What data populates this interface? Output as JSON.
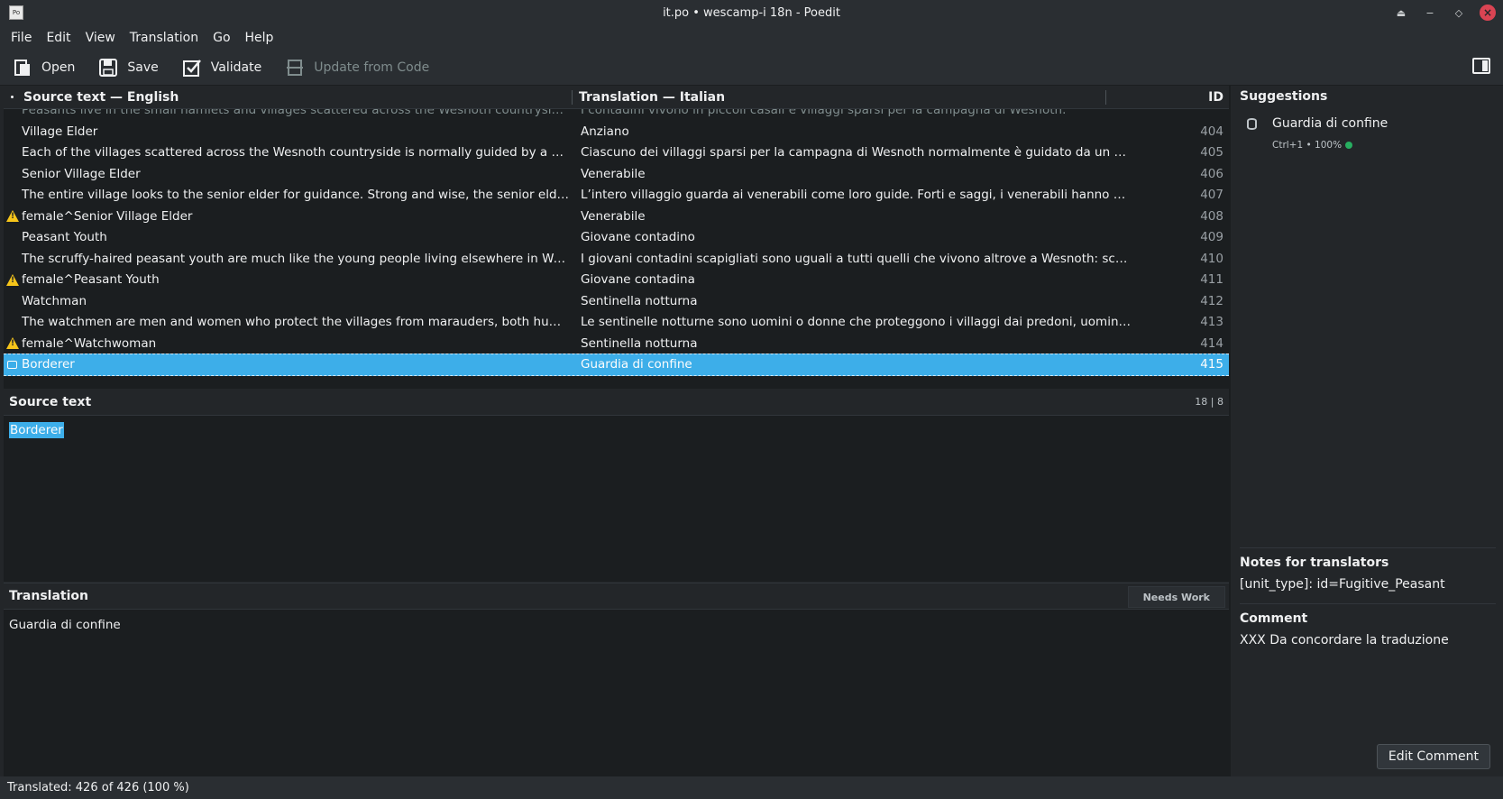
{
  "window": {
    "title": "it.po • wescamp-i 18n - Poedit",
    "icon_name": "poedit-app-icon"
  },
  "menu": [
    "File",
    "Edit",
    "View",
    "Translation",
    "Go",
    "Help"
  ],
  "toolbar": {
    "open": "Open",
    "save": "Save",
    "validate": "Validate",
    "update": "Update from Code"
  },
  "list": {
    "col_source": "Source text — English",
    "col_translation": "Translation — Italian",
    "col_id": "ID",
    "clipped_row": {
      "source": "Peasants live in the small hamlets and villages scattered across the Wesnoth countryside.",
      "translation": "I contadini vivono in piccoli casali e villaggi sparsi per la campagna di Wesnoth."
    },
    "rows": [
      {
        "source": "Village Elder",
        "translation": "Anziano",
        "id": "404",
        "warn": false
      },
      {
        "source": "Each of the villages scattered across the Wesnoth countryside is normally guided by a group of eld...",
        "translation": "Ciascuno dei villaggi sparsi per la campagna di Wesnoth normalmente è guidato da un gruppo di a...",
        "id": "405",
        "warn": false
      },
      {
        "source": "Senior Village Elder",
        "translation": "Venerabile",
        "id": "406",
        "warn": false
      },
      {
        "source": "The entire village looks to the senior elder for guidance. Strong and wise, the senior elders take re...",
        "translation": "L’intero villaggio guarda ai venerabili come loro guide. Forti e saggi, i venerabili hanno proprio sulle ...",
        "id": "407",
        "warn": false
      },
      {
        "source": "female^Senior Village Elder",
        "translation": "Venerabile",
        "id": "408",
        "warn": true
      },
      {
        "source": "Peasant Youth",
        "translation": "Giovane contadino",
        "id": "409",
        "warn": false
      },
      {
        "source": "The scruffy-haired peasant youth are much like the young people living elsewhere in Wesnoth: rec...",
        "translation": "I giovani contadini scapigliati sono uguali a tutti quelli che vivono altrove a Wesnoth: sconsiderati, i...",
        "id": "410",
        "warn": false
      },
      {
        "source": "female^Peasant Youth",
        "translation": "Giovane contadina",
        "id": "411",
        "warn": true
      },
      {
        "source": "Watchman",
        "translation": "Sentinella notturna",
        "id": "412",
        "warn": false
      },
      {
        "source": "The watchmen are men and women who protect the villages from marauders, both human and ot...",
        "translation": "Le sentinelle notturne sono uomini o donne che proteggono i villaggi dai predoni, uomini e non, ch...",
        "id": "413",
        "warn": false
      },
      {
        "source": "female^Watchwoman",
        "translation": "Sentinella notturna",
        "id": "414",
        "warn": true
      },
      {
        "source": "Borderer",
        "translation": "Guardia di confine",
        "id": "415",
        "warn": false,
        "selected": true
      }
    ]
  },
  "editor": {
    "source_label": "Source text",
    "source_counts": "18 | 8",
    "source_value": "Borderer",
    "translation_label": "Translation",
    "needs_work": "Needs Work",
    "translation_value": "Guardia di confine"
  },
  "sidebar": {
    "suggestions_title": "Suggestions",
    "suggestion_text": "Guardia di confine",
    "suggestion_meta": "Ctrl+1 • 100%",
    "notes_title": "Notes for translators",
    "notes_text": "[unit_type]: id=Fugitive_Peasant",
    "comment_title": "Comment",
    "comment_text": "XXX Da concordare la traduzione",
    "edit_comment": "Edit Comment"
  },
  "status": {
    "text": "Translated: 426 of 426 (100 %)"
  },
  "colors": {
    "accent": "#3daee9",
    "warning": "#f6c51a",
    "ok": "#27ae60",
    "close": "#da4453"
  }
}
